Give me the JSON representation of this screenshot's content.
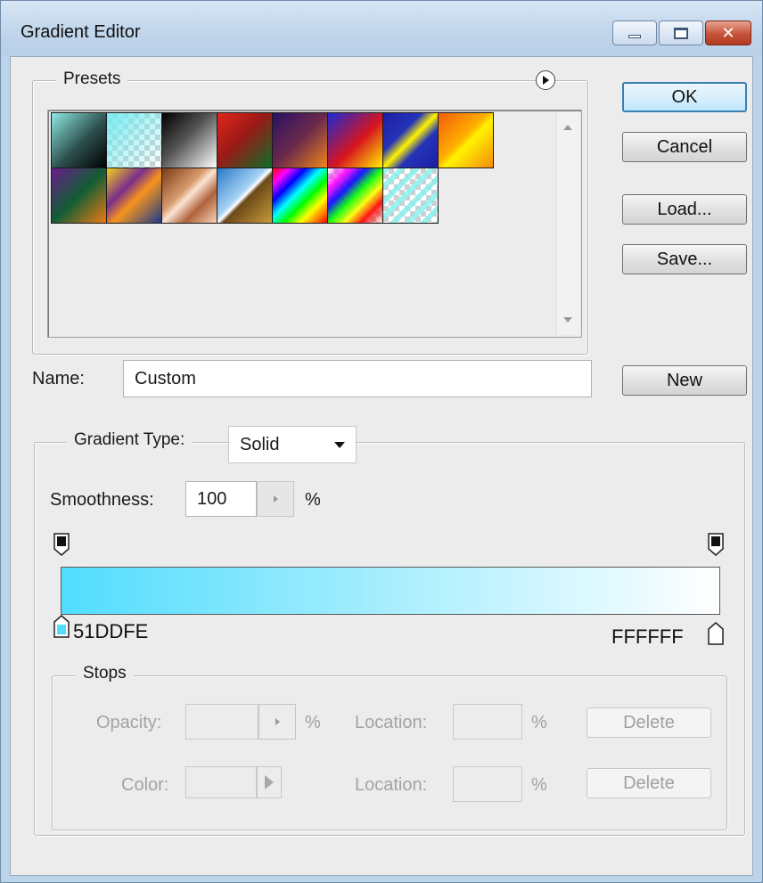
{
  "window": {
    "title": "Gradient Editor",
    "controls": {
      "minimize": "minimize",
      "maximize": "maximize",
      "close": "✕"
    }
  },
  "presets": {
    "legend": "Presets",
    "swatches": [
      {
        "name": "foreground-to-background",
        "fill": "linear-gradient(135deg,#8fe9e3 0%,#2c4f4d 55%,#000 100%)",
        "transparent": false
      },
      {
        "name": "foreground-to-transparent",
        "fill": "linear-gradient(135deg,rgba(120,235,240,1) 0%,rgba(120,235,240,0.5) 50%,rgba(120,235,240,0) 100%)",
        "transparent": true
      },
      {
        "name": "black-white",
        "fill": "linear-gradient(135deg,#000 0%,#555 45%,#fff 100%)",
        "transparent": false
      },
      {
        "name": "red-green",
        "fill": "linear-gradient(135deg,#e2261d 0%,#9a1a16 45%,#0d6e2a 100%)",
        "transparent": false
      },
      {
        "name": "violet-orange",
        "fill": "linear-gradient(135deg,#2a1066 0%,#6b2a4a 50%,#f0861a 100%)",
        "transparent": false
      },
      {
        "name": "blue-red-yellow",
        "fill": "linear-gradient(135deg,#1a2bd4 0%,#d8141e 55%,#fff000 100%)",
        "transparent": false
      },
      {
        "name": "blue-yellow-blue",
        "fill": "linear-gradient(135deg,#1d1ea6 0%,#2433b8 35%,#fff200 50%,#2433b8 65%,#1d1ea6 100%)",
        "transparent": false
      },
      {
        "name": "orange-yellow-orange",
        "fill": "linear-gradient(135deg,#f25d0e 0%,#ffae00 45%,#fff200 55%,#f68a0a 100%)",
        "transparent": false
      },
      {
        "name": "violet-green-orange",
        "fill": "linear-gradient(135deg,#6a1d8c 0%,#125d35 50%,#f07a12 100%)",
        "transparent": false
      },
      {
        "name": "yellow-violet-orange-blue",
        "fill": "linear-gradient(135deg,#f5d117 0%,#7a2e8c 35%,#f7941d 55%,#1a3a8c 100%)",
        "transparent": false
      },
      {
        "name": "copper",
        "fill": "linear-gradient(135deg,#7a3a16 0%,#d89a6c 40%,#fbe3d2 50%,#b0623a 70%,#f4d3bb 100%)",
        "transparent": false
      },
      {
        "name": "chrome",
        "fill": "linear-gradient(135deg,#2877c8 0%,#a8d4f4 45%,#ffffff 50%,#6b4a1a 55%,#c99b3a 100%)",
        "transparent": false
      },
      {
        "name": "spectrum",
        "fill": "linear-gradient(135deg,#ff0000 0%,#ff00ff 15%,#0000ff 30%,#00ffff 45%,#00ff00 60%,#ffff00 75%,#ff0000 100%)",
        "transparent": false
      },
      {
        "name": "transparent-rainbow",
        "fill": "linear-gradient(135deg,rgba(255,0,0,0) 0%,rgba(255,0,255,0.9) 20%,rgba(0,0,255,0.9) 35%,rgba(0,255,0,0.9) 50%,rgba(255,255,0,0.9) 65%,rgba(255,0,0,0.9) 80%,rgba(255,0,0,0) 100%)",
        "transparent": true
      },
      {
        "name": "transparent-stripes",
        "fill": "repeating-linear-gradient(135deg,rgba(140,240,240,0.85) 0px,rgba(140,240,240,0.85) 6px,rgba(140,240,240,0) 6px,rgba(140,240,240,0) 12px)",
        "transparent": true
      }
    ]
  },
  "buttons": {
    "ok": "OK",
    "cancel": "Cancel",
    "load": "Load...",
    "save": "Save...",
    "new": "New"
  },
  "name_field": {
    "label": "Name:",
    "value": "Custom"
  },
  "gradient_type": {
    "label": "Gradient Type:",
    "value": "Solid"
  },
  "smoothness": {
    "label": "Smoothness:",
    "value": "100",
    "unit": "%"
  },
  "gradient": {
    "start_color": "#51DDFE",
    "end_color": "#FFFFFF",
    "start_label": "51DDFE",
    "end_label": "FFFFFF"
  },
  "stops": {
    "legend": "Stops",
    "opacity_label": "Opacity:",
    "opacity_unit": "%",
    "location_label": "Location:",
    "location_unit": "%",
    "color_label": "Color:",
    "delete_label": "Delete"
  },
  "colors": {
    "accent_border": "#3c7fb1",
    "window_frame": "#bcd3ea",
    "close_button": "#c5533a"
  }
}
